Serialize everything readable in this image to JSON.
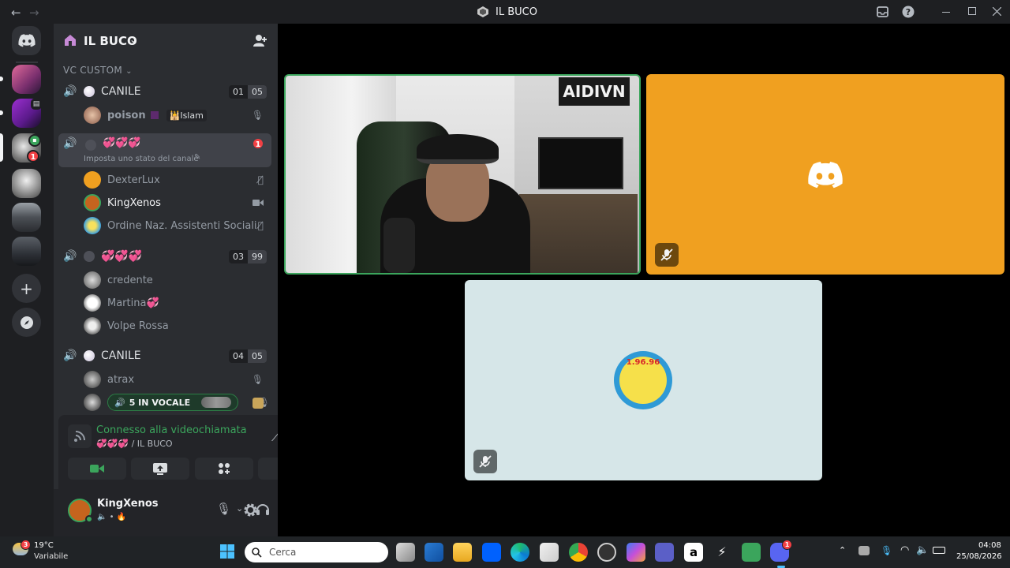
{
  "titlebar": {
    "title": "IL BUCO",
    "back": "←",
    "forward": "→"
  },
  "server": {
    "name": "IL BUCO",
    "category": "VC CUSTOM"
  },
  "channels": [
    {
      "name": "CANILE",
      "count_a": "01",
      "count_b": "05",
      "users": [
        {
          "name": "poison",
          "tag": "Islam"
        }
      ]
    },
    {
      "name": "💞💞💞",
      "status": "Imposta uno stato del canale",
      "badge": "1",
      "users": [
        {
          "name": "DexterLux"
        },
        {
          "name": "KingXenos"
        },
        {
          "name": "Ordine Naz. Assistenti Sociali"
        }
      ]
    },
    {
      "name": "💞💞💞",
      "count_a": "03",
      "count_b": "99",
      "users": [
        {
          "name": "credente"
        },
        {
          "name": "Martina💞"
        },
        {
          "name": "Volpe Rossa"
        }
      ]
    },
    {
      "name": "CANILE",
      "count_a": "04",
      "count_b": "05",
      "users": [
        {
          "name": "atrax"
        }
      ],
      "live_label": "5 IN VOCALE"
    }
  ],
  "voice": {
    "status": "Connesso alla videochiamata",
    "location": "💞💞💞 / IL BUCO"
  },
  "me": {
    "name": "KingXenos",
    "sub": "🔈 • 🔥"
  },
  "rail_badge": "1",
  "taskbar": {
    "weather_temp": "19°C",
    "weather_desc": "Variabile",
    "weather_badge": "3",
    "search_placeholder": "Cerca",
    "time": "04:08",
    "date": "25/08/2026",
    "discord_badge": "1"
  },
  "tile_logo_text": "1.96.96",
  "colors": {
    "discord_orange": "#f0a020",
    "tile_light": "#d6e6e8",
    "voice_green": "#3ba55c"
  }
}
